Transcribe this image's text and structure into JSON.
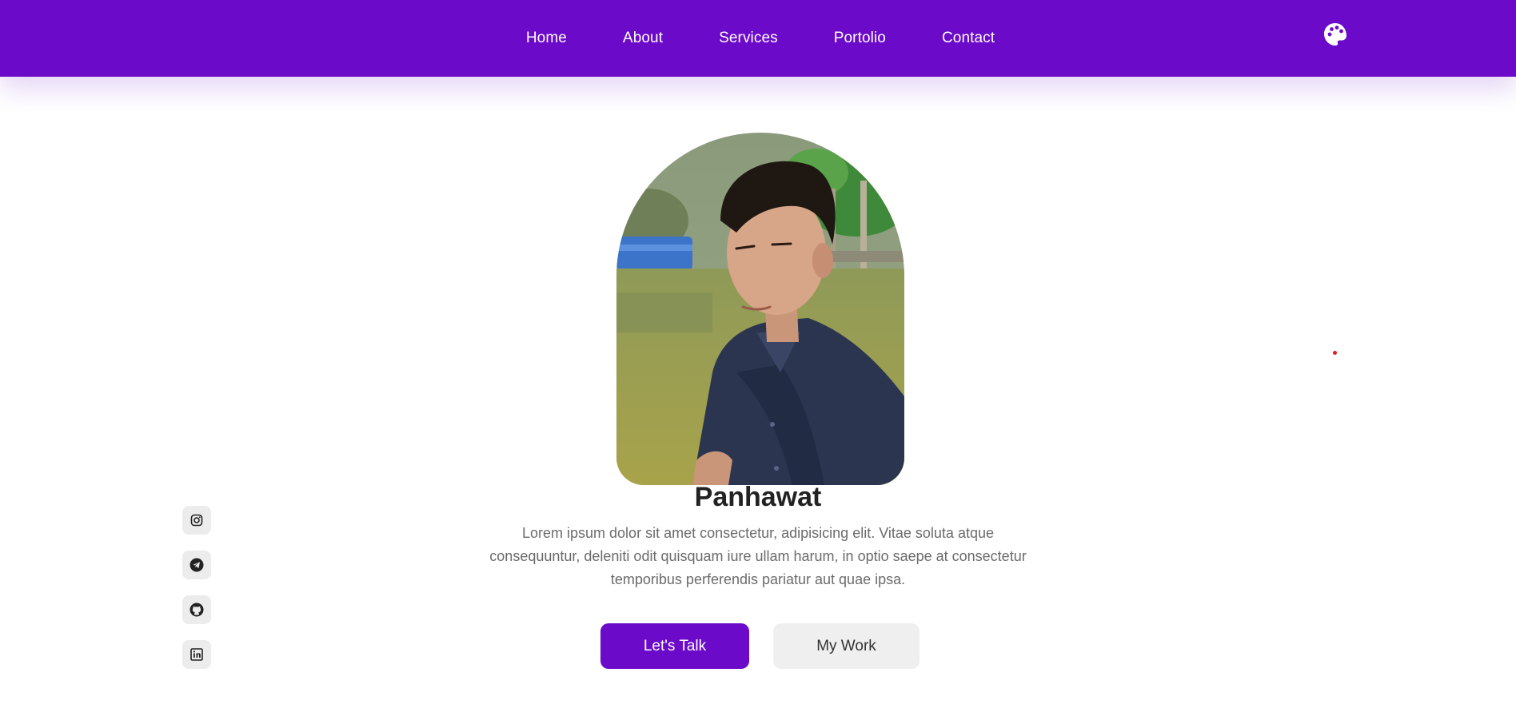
{
  "nav": {
    "items": [
      {
        "label": "Home"
      },
      {
        "label": "About"
      },
      {
        "label": "Services"
      },
      {
        "label": "Portolio"
      },
      {
        "label": "Contact"
      }
    ],
    "theme_icon": "palette-icon"
  },
  "hero": {
    "photo_icon": "profile-photo",
    "name": "Panhawat",
    "description": "Lorem ipsum dolor sit amet consectetur, adipisicing elit. Vitae soluta atque consequuntur, deleniti odit quisquam iure ullam harum, in optio saepe at consectetur temporibus perferendis pariatur aut quae ipsa.",
    "primary_button": "Let's Talk",
    "secondary_button": "My Work"
  },
  "social": [
    {
      "icon": "instagram-icon"
    },
    {
      "icon": "telegram-icon"
    },
    {
      "icon": "github-icon"
    },
    {
      "icon": "linkedin-icon"
    }
  ],
  "colors": {
    "brand": "#6c0ac9",
    "button_secondary": "#efefef",
    "text_dark": "#222222",
    "text_muted": "#6b6b6b",
    "cursor_dot": "#e02020"
  }
}
